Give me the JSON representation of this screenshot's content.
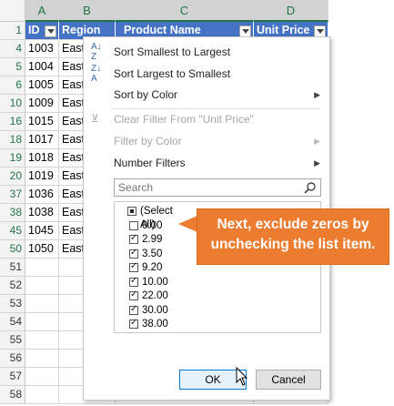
{
  "columns": [
    "A",
    "B",
    "C",
    "D"
  ],
  "header_row": {
    "row_number": "1",
    "cells": [
      "ID",
      "Region",
      "Product Name",
      "Unit Price"
    ]
  },
  "rows": [
    {
      "num": "4",
      "id": "1003",
      "region": "East"
    },
    {
      "num": "5",
      "id": "1004",
      "region": "East"
    },
    {
      "num": "6",
      "id": "1005",
      "region": "East"
    },
    {
      "num": "10",
      "id": "1009",
      "region": "East"
    },
    {
      "num": "16",
      "id": "1015",
      "region": "East"
    },
    {
      "num": "18",
      "id": "1017",
      "region": "East"
    },
    {
      "num": "19",
      "id": "1018",
      "region": "East"
    },
    {
      "num": "20",
      "id": "1019",
      "region": "East"
    },
    {
      "num": "37",
      "id": "1036",
      "region": "East"
    },
    {
      "num": "38",
      "id": "1038",
      "region": "East"
    },
    {
      "num": "45",
      "id": "1045",
      "region": "East"
    },
    {
      "num": "50",
      "id": "1050",
      "region": "East"
    },
    {
      "num": "51",
      "id": "",
      "region": ""
    },
    {
      "num": "52",
      "id": "",
      "region": ""
    },
    {
      "num": "53",
      "id": "",
      "region": ""
    },
    {
      "num": "54",
      "id": "",
      "region": ""
    },
    {
      "num": "55",
      "id": "",
      "region": ""
    },
    {
      "num": "56",
      "id": "",
      "region": ""
    },
    {
      "num": "57",
      "id": "",
      "region": ""
    },
    {
      "num": "58",
      "id": "",
      "region": ""
    }
  ],
  "menu": {
    "sort_asc": "Sort Smallest to Largest",
    "sort_desc": "Sort Largest to Smallest",
    "sort_by_color": "Sort by Color",
    "clear_filter": "Clear Filter From \"Unit Price\"",
    "filter_by_color": "Filter by Color",
    "number_filters": "Number Filters",
    "search_placeholder": "Search",
    "ok": "OK",
    "cancel": "Cancel"
  },
  "filter_items": [
    {
      "label": "(Select All)",
      "state": "partial"
    },
    {
      "label": "0.00",
      "state": "unchecked"
    },
    {
      "label": "2.99",
      "state": "checked"
    },
    {
      "label": "3.50",
      "state": "checked"
    },
    {
      "label": "9.20",
      "state": "checked"
    },
    {
      "label": "10.00",
      "state": "checked"
    },
    {
      "label": "22.00",
      "state": "checked"
    },
    {
      "label": "30.00",
      "state": "checked"
    },
    {
      "label": "38.00",
      "state": "checked"
    }
  ],
  "callout": {
    "line1": "Next, exclude zeros by",
    "line2": "unchecking the list item."
  },
  "colors": {
    "header_fill": "#4472c4",
    "callout_fill": "#ec7c2f",
    "excel_green": "#217346"
  }
}
